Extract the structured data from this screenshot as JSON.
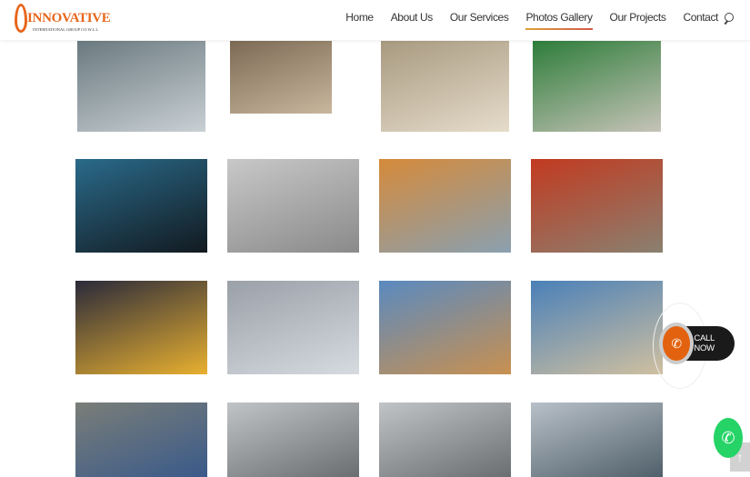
{
  "header": {
    "logo_name": "INNOVATIVE",
    "logo_sub": "INTERNATIONAL GROUP CO.W.L.L",
    "nav": [
      {
        "label": "Home"
      },
      {
        "label": "About Us"
      },
      {
        "label": "Our Services"
      },
      {
        "label": "Photos Gallery",
        "active": true
      },
      {
        "label": "Our Projects"
      },
      {
        "label": "Contact"
      }
    ]
  },
  "gallery": {
    "photos": [
      [
        "#6b7a80",
        "#c9d0d4"
      ],
      [
        "#7d6a55",
        "#c7b79d"
      ],
      [
        "#a89a80",
        "#e6dccb"
      ],
      [
        "#2e7d3a",
        "#c6c3b8"
      ],
      [
        "#2a6a8a",
        "#121a20"
      ],
      [
        "#c8c8c8",
        "#8a8a8a"
      ],
      [
        "#d58a3a",
        "#8aa0b0"
      ],
      [
        "#c23a20",
        "#8a8070"
      ],
      [
        "#2a2a3a",
        "#e8b030"
      ],
      [
        "#9aa0a8",
        "#d6dbe0"
      ],
      [
        "#5a8ac0",
        "#c89050"
      ],
      [
        "#4a80b8",
        "#d0c0a0"
      ],
      [
        "#7a7e78",
        "#3a5a8a"
      ],
      [
        "#c0c4c6",
        "#6a6e70"
      ],
      [
        "#c0c4c6",
        "#6a6e70"
      ],
      [
        "#b8c0c8",
        "#50606a"
      ]
    ]
  },
  "call_now": {
    "label": "CALL NOW"
  },
  "whatsapp": {
    "icon": "whatsapp-icon"
  },
  "scroll_top": {
    "icon": "arrow-up-icon"
  }
}
